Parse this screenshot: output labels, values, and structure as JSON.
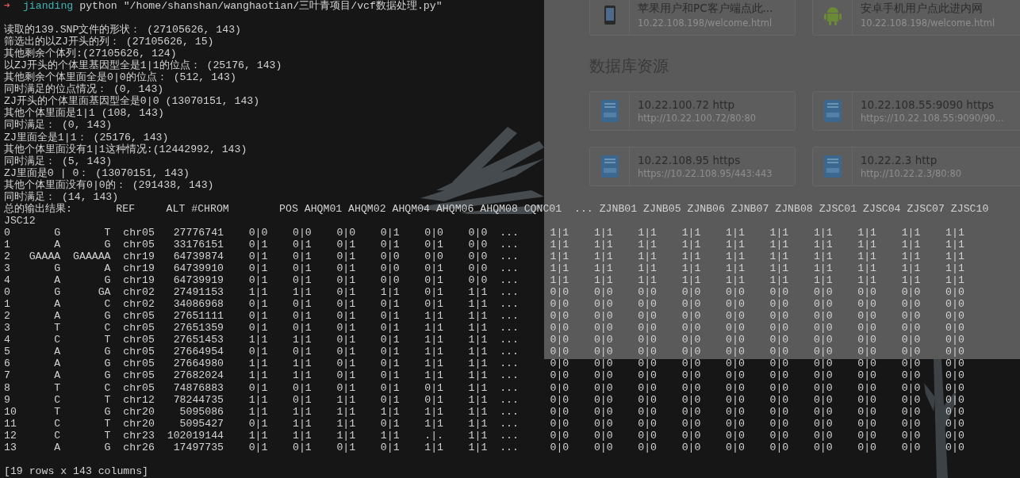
{
  "terminal": {
    "prompt": {
      "arrow": "➜",
      "directory": "jianding",
      "command": "python \"/home/shanshan/wanghaotian/三叶青项目/vcf数据处理.py\""
    },
    "lines": [
      "读取的139.SNP文件的形状： (27105626, 143)",
      "筛选出的以ZJ开头的列： (27105626, 15)",
      "其他剩余个体列:(27105626, 124)",
      "以ZJ开头的个体里基因型全是1|1的位点： (25176, 143)",
      "其他剩余个体里面全是0|0的位点： (512, 143)",
      "同时满足的位点情况： (0, 143)",
      "ZJ开头的个体里面基因型全是0|0 (13070151, 143)",
      "其他个体里面是1|1 (108, 143)",
      "同时满足： (0, 143)",
      "ZJ里面全是1|1： (25176, 143)",
      "其他个体里面没有1|1这种情况:(12442992, 143)",
      "同时满足： (5, 143)",
      "ZJ里面是0 | 0： (13070151, 143)",
      "其他个体里面没有0|0的： (291438, 143)",
      "同时满足： (14, 143)"
    ],
    "table": {
      "header": "总的输出结果:       REF     ALT #CHROM        POS AHQM01 AHQM02 AHQM04 AHQM06 AHQM08 CQNC01  ... ZJNB01 ZJNB05 ZJNB06 ZJNB07 ZJNB08 ZJSC01 ZJSC04 ZJSC07 ZJSC10",
      "header_wrap": "JSC12",
      "rows": [
        "0       G       T  chr05   27776741    0|0    0|0    0|0    0|1    0|0    0|0  ...     1|1    1|1    1|1    1|1    1|1    1|1    1|1    1|1    1|1    1|1",
        "1       A       G  chr05   33176151    0|1    0|1    0|1    0|1    0|1    0|0  ...     1|1    1|1    1|1    1|1    1|1    1|1    1|1    1|1    1|1    1|1",
        "2   GAAAA  GAAAAA  chr19   64739874    0|1    0|1    0|1    0|0    0|0    0|0  ...     1|1    1|1    1|1    1|1    1|1    1|1    1|1    1|1    1|1    1|1",
        "3       G       A  chr19   64739910    0|1    0|1    0|1    0|0    0|1    0|0  ...     1|1    1|1    1|1    1|1    1|1    1|1    1|1    1|1    1|1    1|1",
        "4       A       G  chr19   64739919    0|1    0|1    0|1    0|0    0|1    0|0  ...     1|1    1|1    1|1    1|1    1|1    1|1    1|1    1|1    1|1    1|1",
        "0       G      GA  chr02   27491153    1|1    1|1    0|1    1|1    0|1    1|1  ...     0|0    0|0    0|0    0|0    0|0    0|0    0|0    0|0    0|0    0|0",
        "1       A       C  chr02   34086968    0|1    0|1    0|1    0|1    0|1    1|1  ...     0|0    0|0    0|0    0|0    0|0    0|0    0|0    0|0    0|0    0|0",
        "2       A       G  chr05   27651111    0|1    0|1    0|1    0|1    1|1    1|1  ...     0|0    0|0    0|0    0|0    0|0    0|0    0|0    0|0    0|0    0|0",
        "3       T       C  chr05   27651359    0|1    0|1    0|1    0|1    1|1    1|1  ...     0|0    0|0    0|0    0|0    0|0    0|0    0|0    0|0    0|0    0|0",
        "4       C       T  chr05   27651453    1|1    1|1    0|1    0|1    1|1    1|1  ...     0|0    0|0    0|0    0|0    0|0    0|0    0|0    0|0    0|0    0|0",
        "5       A       G  chr05   27664954    0|1    0|1    0|1    0|1    1|1    1|1  ...     0|0    0|0    0|0    0|0    0|0    0|0    0|0    0|0    0|0    0|0",
        "6       A       G  chr05   27664980    1|1    1|1    0|1    0|1    1|1    1|1  ...     0|0    0|0    0|0    0|0    0|0    0|0    0|0    0|0    0|0    0|0",
        "7       A       G  chr05   27682024    1|1    1|1    0|1    0|1    1|1    1|1  ...     0|0    0|0    0|0    0|0    0|0    0|0    0|0    0|0    0|0    0|0",
        "8       T       C  chr05   74876883    0|1    0|1    0|1    0|1    0|1    1|1  ...     0|0    0|0    0|0    0|0    0|0    0|0    0|0    0|0    0|0    0|0",
        "9       C       T  chr12   78244735    1|1    0|1    1|1    0|1    0|1    1|1  ...     0|0    0|0    0|0    0|0    0|0    0|0    0|0    0|0    0|0    0|0",
        "10      T       G  chr20    5095086    1|1    1|1    1|1    1|1    1|1    1|1  ...     0|0    0|0    0|0    0|0    0|0    0|0    0|0    0|0    0|0    0|0",
        "11      C       T  chr20    5095427    0|1    1|1    1|1    0|1    1|1    1|1  ...     0|0    0|0    0|0    0|0    0|0    0|0    0|0    0|0    0|0    0|0",
        "12      C       T  chr23  102019144    1|1    1|1    1|1    1|1    .|.    1|1  ...     0|0    0|0    0|0    0|0    0|0    0|0    0|0    0|0    0|0    0|0",
        "13      A       G  chr26   17497735    0|1    0|1    0|1    0|1    1|1    1|1  ...     0|0    0|0    0|0    0|0    0|0    0|0    0|0    0|0    0|0    0|0"
      ],
      "summary": "[19 rows x 143 columns]"
    }
  },
  "browser": {
    "top_links": [
      {
        "kind": "phone",
        "title": "苹果用户和PC客户端点此...",
        "url": "10.22.108.198/welcome.html"
      },
      {
        "kind": "android",
        "title": "安卓手机用户点此进内网",
        "url": "10.22.108.198/welcome.html"
      }
    ],
    "section": {
      "title": "数据库资源",
      "links": [
        {
          "kind": "book",
          "title": "10.22.100.72  http",
          "url": "http://10.22.100.72/80:80"
        },
        {
          "kind": "book",
          "title": "10.22.108.55:9090  https",
          "url": "https://10.22.108.55:9090/90..."
        },
        {
          "kind": "book",
          "title": "10.22.108.95  https",
          "url": "https://10.22.108.95/443:443"
        },
        {
          "kind": "book",
          "title": "10.22.2.3  http",
          "url": "http://10.22.2.3/80:80"
        }
      ]
    }
  }
}
